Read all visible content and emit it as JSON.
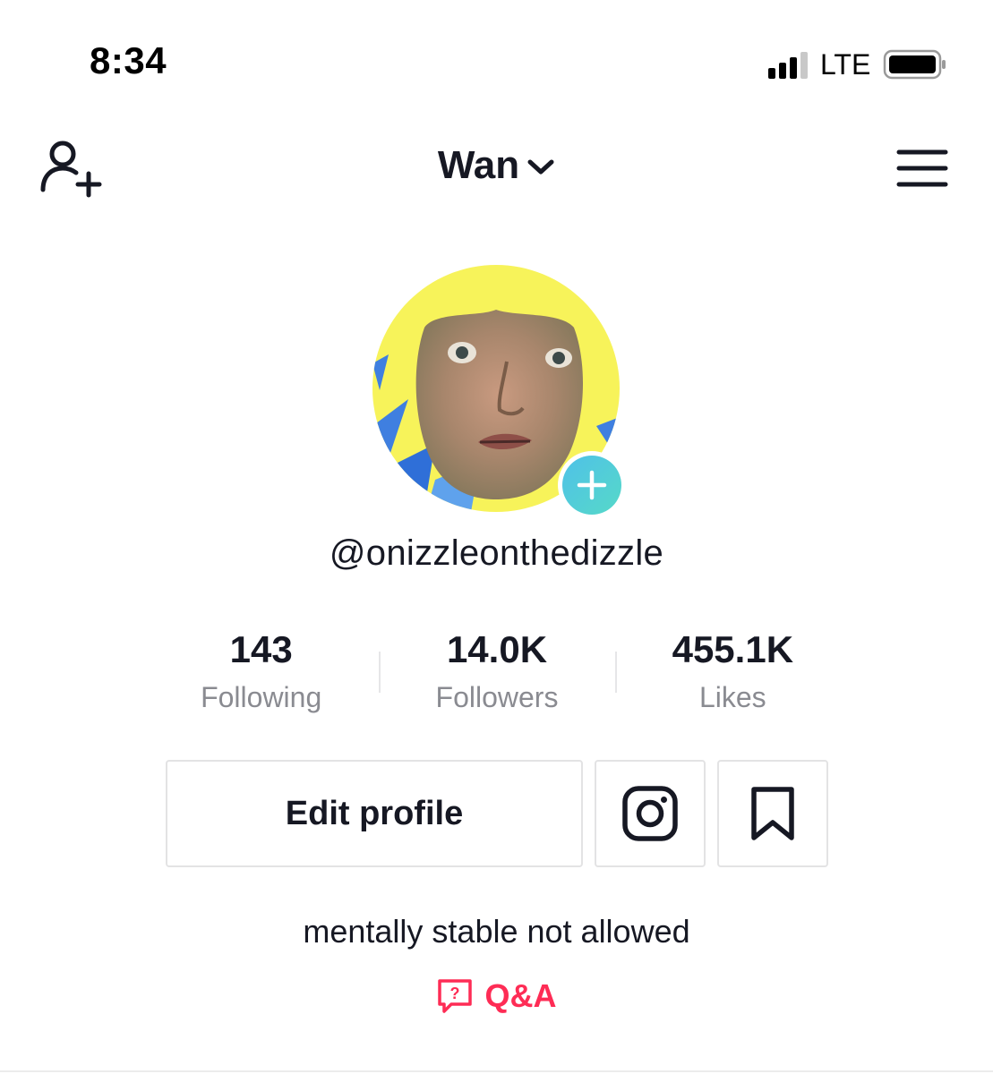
{
  "status_bar": {
    "time": "8:34",
    "network": "LTE",
    "signal_bars_filled": 3,
    "signal_bars_total": 4
  },
  "nav": {
    "title": "Wan",
    "left_icon": "add-user-icon",
    "title_icon": "chevron-down-icon",
    "right_icon": "hamburger-menu-icon"
  },
  "profile": {
    "avatar_icon": "avatar",
    "username": "@onizzleonthedizzle",
    "bio": "mentally stable not allowed"
  },
  "stats": [
    {
      "value": "143",
      "label": "Following"
    },
    {
      "value": "14.0K",
      "label": "Followers"
    },
    {
      "value": "455.1K",
      "label": "Likes"
    }
  ],
  "actions": {
    "edit_profile_label": "Edit profile",
    "instagram_icon": "instagram-icon",
    "bookmark_icon": "bookmark-icon"
  },
  "qa": {
    "label": "Q&A",
    "icon": "question-bubble-icon"
  },
  "colors": {
    "text_primary": "#161823",
    "text_secondary": "#8a8b91",
    "accent_red": "#fe2c55",
    "border": "#e3e3e4",
    "add_badge": "#4fc1e8"
  }
}
